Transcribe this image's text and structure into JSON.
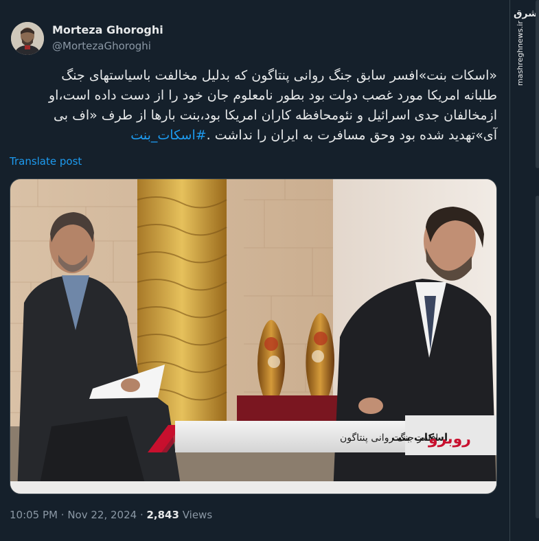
{
  "author": {
    "display_name": "Morteza Ghoroghi",
    "handle": "@MortezaGhoroghi"
  },
  "post": {
    "line1": "«اسکات بنت»افسر سابق جنگ روانی پنتاگون که بدلیل مخالفت باسیاستهای جنگ",
    "line2": "طلبانه امریکا مورد غصب دولت بود بطور نامعلوم جان خود را از دست داده است،او",
    "line3": "ازمخالفان جدی اسرائیل و نئومحافظه کاران امریکا بود،بنت بارها از طرف «اف بی",
    "line4": "آی»تهدید شده بود وحق مسافرت به ایران را نداشت .",
    "hashtag": "#اسکات_بنت",
    "translate_label": "Translate post"
  },
  "media": {
    "lower_third_name": "اسکات بنت",
    "lower_third_title": "افسر جنگ روانی پنتاگون",
    "show_logo": "روبرو"
  },
  "meta": {
    "time": "10:05 PM",
    "date": "Nov 22, 2024",
    "views_count": "2,843",
    "views_label": "Views"
  },
  "watermark": {
    "logo": "مشرق",
    "url": "mashreghnews.ir"
  },
  "colors": {
    "background": "#15202b",
    "link": "#1d9bf0",
    "secondary_text": "#8b98a5",
    "primary_text": "#e7e9ea",
    "lower_third_red": "#c8102e"
  },
  "icons": {
    "more": "more-horizontal-icon"
  }
}
